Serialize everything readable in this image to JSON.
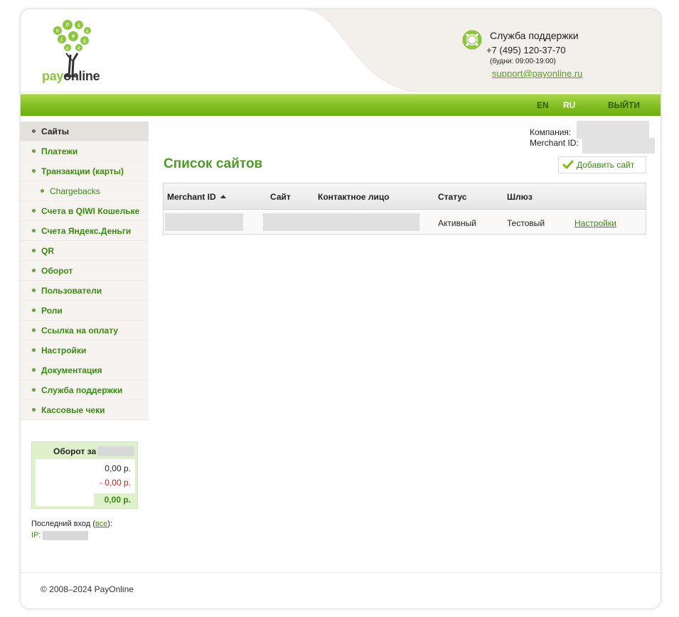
{
  "brand": {
    "logo_pay": "pay",
    "logo_online": "online",
    "logo_coin_letters": [
      "R",
      "P",
      "$",
      "€",
      "£",
      "¥",
      "$",
      "€",
      "₽"
    ]
  },
  "support": {
    "title": "Служба поддержки",
    "phone": "+7 (495) 120-37-70",
    "hours": "(будни: 09:00-19:00)",
    "email": "support@payonline.ru"
  },
  "topnav": {
    "lang_en": "EN",
    "lang_ru": "RU",
    "logout": "ВЫЙТИ"
  },
  "sidebar": {
    "items": [
      {
        "label": "Сайты",
        "active": true,
        "sub": false
      },
      {
        "label": "Платежи",
        "active": false,
        "sub": false
      },
      {
        "label": "Транзакции (карты)",
        "active": false,
        "sub": false
      },
      {
        "label": "Chargebacks",
        "active": false,
        "sub": true
      },
      {
        "label": "Счета в QIWI Кошельке",
        "active": false,
        "sub": false
      },
      {
        "label": "Счета Яндекс.Деньги",
        "active": false,
        "sub": false
      },
      {
        "label": "QR",
        "active": false,
        "sub": false
      },
      {
        "label": "Оборот",
        "active": false,
        "sub": false
      },
      {
        "label": "Пользователи",
        "active": false,
        "sub": false
      },
      {
        "label": "Роли",
        "active": false,
        "sub": false
      },
      {
        "label": "Ссылка на оплату",
        "active": false,
        "sub": false
      },
      {
        "label": "Настройки",
        "active": false,
        "sub": false
      },
      {
        "label": "Документация",
        "active": false,
        "sub": false
      },
      {
        "label": "Служба поддержки",
        "active": false,
        "sub": false
      },
      {
        "label": "Кассовые чеки",
        "active": false,
        "sub": false
      }
    ]
  },
  "turnover": {
    "title": "Оборот за",
    "income": "0,00 р.",
    "outgo": "- 0,00 р.",
    "total": "0,00 р."
  },
  "last_login": {
    "label": "Последний вход",
    "all_link": "все",
    "ip_label": "IP:"
  },
  "company_info": {
    "company_label": "Компания:",
    "merchant_label": "Merchant ID:"
  },
  "main": {
    "title": "Список сайтов",
    "add_button": "Добавить сайт",
    "table": {
      "headers": [
        "Merchant ID",
        "Сайт",
        "Контактное лицо",
        "Статус",
        "Шлюз"
      ],
      "rows": [
        {
          "status": "Активный",
          "gateway": "Тестовый",
          "action": "Настройки"
        }
      ]
    }
  },
  "footer": {
    "copyright": "© 2008–2024 PayOnline"
  },
  "colors": {
    "brand_green": "#8cc63f",
    "link_green": "#3a8a12",
    "title_green": "#4f9a2a",
    "negative_red": "#c81e1e"
  }
}
